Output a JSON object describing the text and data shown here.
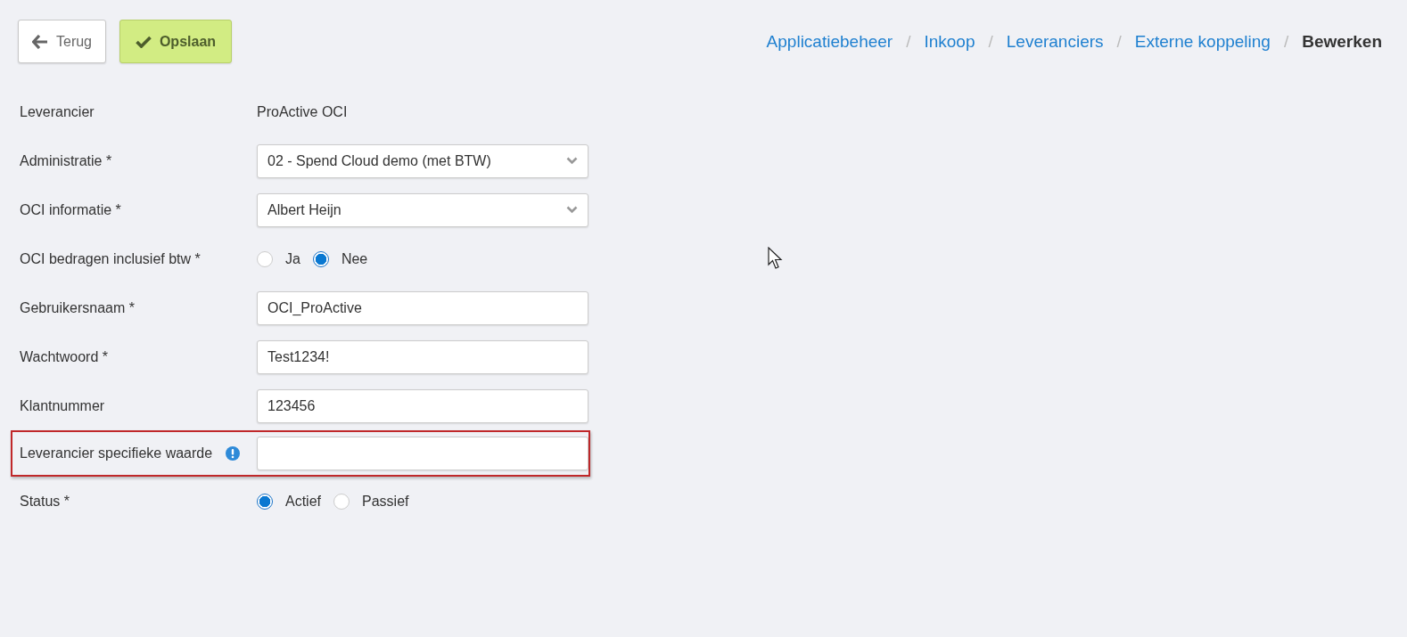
{
  "toolbar": {
    "buttons": [
      {
        "label": "Terug",
        "kind": "back"
      },
      {
        "label": "Opslaan",
        "kind": "save"
      }
    ]
  },
  "breadcrumb": [
    {
      "kind": "link",
      "text": "Applicatiebeheer"
    },
    {
      "kind": "separator",
      "text": "/"
    },
    {
      "kind": "link",
      "text": "Inkoop"
    },
    {
      "kind": "separator",
      "text": "/"
    },
    {
      "kind": "link",
      "text": "Leveranciers"
    },
    {
      "kind": "separator",
      "text": "/"
    },
    {
      "kind": "link",
      "text": "Externe koppeling"
    },
    {
      "kind": "separator",
      "text": "/"
    },
    {
      "kind": "current",
      "text": "Bewerken"
    }
  ],
  "form": [
    {
      "kind": "static",
      "label": "Leverancier",
      "value": "ProActive OCI",
      "highlighted": false
    },
    {
      "kind": "select",
      "label": "Administratie *",
      "value": "02 - Spend Cloud demo (met BTW)",
      "highlighted": false
    },
    {
      "kind": "select",
      "label": "OCI informatie *",
      "value": "Albert Heijn",
      "highlighted": false
    },
    {
      "kind": "radio",
      "label": "OCI bedragen inclusief btw *",
      "highlighted": false,
      "options": [
        {
          "label": "Ja",
          "selected": false
        },
        {
          "label": "Nee",
          "selected": true
        }
      ]
    },
    {
      "kind": "input",
      "label": "Gebruikersnaam *",
      "value": "OCI_ProActive",
      "highlighted": false
    },
    {
      "kind": "input",
      "label": "Wachtwoord *",
      "value": "Test1234!",
      "highlighted": false
    },
    {
      "kind": "input",
      "label": "Klantnummer",
      "value": "123456",
      "highlighted": false
    },
    {
      "kind": "input",
      "label": "Leverancier specifieke waarde",
      "info": true,
      "highlighted": true
    },
    {
      "kind": "radio",
      "label": "Status *",
      "highlighted": false,
      "options": [
        {
          "label": "Actief",
          "selected": true
        },
        {
          "label": "Passief",
          "selected": false
        }
      ]
    }
  ]
}
